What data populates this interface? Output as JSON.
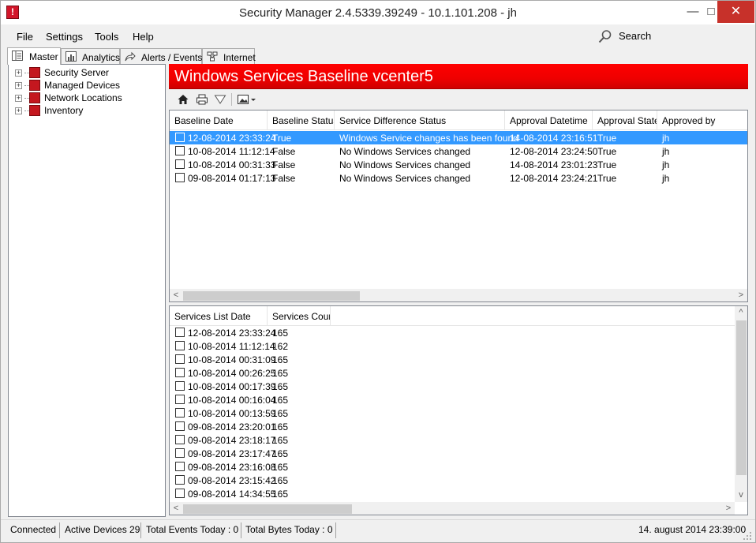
{
  "window": {
    "title": "Security Manager 2.4.5339.39249 - 10.1.101.208 - jh",
    "app_icon_text": "!",
    "minimize_glyph": "—",
    "maximize_glyph": "□",
    "close_glyph": "✕"
  },
  "menu": {
    "items": [
      "File",
      "Settings",
      "Tools",
      "Help"
    ],
    "search_label": "Search"
  },
  "tabs": [
    {
      "label": "Master",
      "icon": "list-icon",
      "active": true
    },
    {
      "label": "Analytics",
      "icon": "bar-chart-icon",
      "active": false
    },
    {
      "label": "Alerts / Events",
      "icon": "share-arrow-icon",
      "active": false
    },
    {
      "label": "Internet",
      "icon": "network-icon",
      "active": false
    }
  ],
  "tree": {
    "items": [
      {
        "label": "Security Server",
        "icon": "security-server-icon"
      },
      {
        "label": "Managed Devices",
        "icon": "managed-devices-icon"
      },
      {
        "label": "Network Locations",
        "icon": "network-locations-icon"
      },
      {
        "label": "Inventory",
        "icon": "inventory-icon"
      }
    ],
    "expand_glyph": "+"
  },
  "header": {
    "title": "Windows Services Baseline vcenter5"
  },
  "toolbar": {
    "icons": [
      "home-icon",
      "print-icon",
      "filter-icon",
      "image-icon",
      "dropdown-arrow-icon"
    ]
  },
  "baseline_grid": {
    "columns": [
      "Baseline Date",
      "Baseline Status",
      "Service Difference Status",
      "Approval Datetime",
      "Approval State",
      "Approved by"
    ],
    "rows": [
      {
        "baseline_date": "12-08-2014 23:33:24",
        "baseline_status": "True",
        "difference_status": "Windows Service changes has been found",
        "approval_datetime": "14-08-2014 23:16:51",
        "approval_state": "True",
        "approved_by": "jh",
        "selected": true
      },
      {
        "baseline_date": "10-08-2014 11:12:14",
        "baseline_status": "False",
        "difference_status": "No Windows Services changed",
        "approval_datetime": "12-08-2014 23:24:50",
        "approval_state": "True",
        "approved_by": "jh",
        "selected": false
      },
      {
        "baseline_date": "10-08-2014 00:31:33",
        "baseline_status": "False",
        "difference_status": "No Windows Services changed",
        "approval_datetime": "14-08-2014 23:01:23",
        "approval_state": "True",
        "approved_by": "jh",
        "selected": false
      },
      {
        "baseline_date": "09-08-2014 01:17:13",
        "baseline_status": "False",
        "difference_status": "No Windows Services changed",
        "approval_datetime": "12-08-2014 23:24:21",
        "approval_state": "True",
        "approved_by": "jh",
        "selected": false
      }
    ]
  },
  "services_grid": {
    "columns": [
      "Services List Date",
      "Services Count"
    ],
    "rows": [
      {
        "date": "12-08-2014 23:33:24",
        "count": "165"
      },
      {
        "date": "10-08-2014 11:12:14",
        "count": "162"
      },
      {
        "date": "10-08-2014 00:31:09",
        "count": "165"
      },
      {
        "date": "10-08-2014 00:26:25",
        "count": "165"
      },
      {
        "date": "10-08-2014 00:17:39",
        "count": "165"
      },
      {
        "date": "10-08-2014 00:16:04",
        "count": "165"
      },
      {
        "date": "10-08-2014 00:13:59",
        "count": "165"
      },
      {
        "date": "09-08-2014 23:20:01",
        "count": "165"
      },
      {
        "date": "09-08-2014 23:18:17",
        "count": "165"
      },
      {
        "date": "09-08-2014 23:17:47",
        "count": "165"
      },
      {
        "date": "09-08-2014 23:16:08",
        "count": "165"
      },
      {
        "date": "09-08-2014 23:15:42",
        "count": "165"
      },
      {
        "date": "09-08-2014 14:34:55",
        "count": "165"
      }
    ]
  },
  "scroll_glyphs": {
    "left": "<",
    "right": ">",
    "up": "^",
    "down": "v"
  },
  "status": {
    "connection": "Connected",
    "active_devices": "Active Devices 29",
    "total_events": "Total Events Today : 0",
    "total_bytes": "Total Bytes Today : 0",
    "datetime": "14. august 2014 23:39:00"
  },
  "colors": {
    "header_red": "#ff0000",
    "selection_blue": "#3399ff",
    "close_button_red": "#c7312a"
  }
}
